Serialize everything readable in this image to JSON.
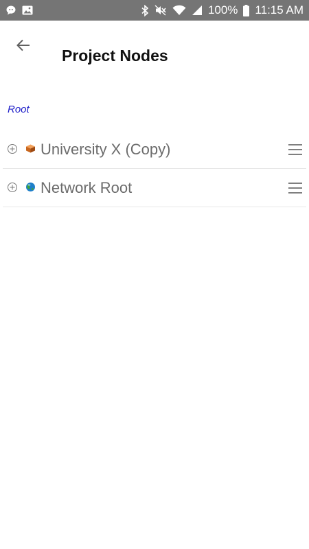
{
  "status_bar": {
    "left_icons": [
      "chat-bubble-icon",
      "image-icon"
    ],
    "right_icons": [
      "bluetooth-icon",
      "mute-icon",
      "wifi-icon",
      "signal-icon",
      "battery-icon"
    ],
    "battery": "100%",
    "time": "11:15 AM",
    "background": "#757575"
  },
  "header": {
    "back_icon": "arrow-left-icon",
    "title": "Project Nodes"
  },
  "breadcrumb": {
    "root_label": "Root",
    "color": "#1c1cc8"
  },
  "nodes": [
    {
      "label": "University X (Copy)",
      "icon": "orange-cube-icon",
      "expand_icon": "plus-circle-icon",
      "menu_icon": "hamburger-menu-icon"
    },
    {
      "label": "Network Root",
      "icon": "globe-icon",
      "expand_icon": "plus-circle-icon",
      "menu_icon": "hamburger-menu-icon"
    }
  ]
}
